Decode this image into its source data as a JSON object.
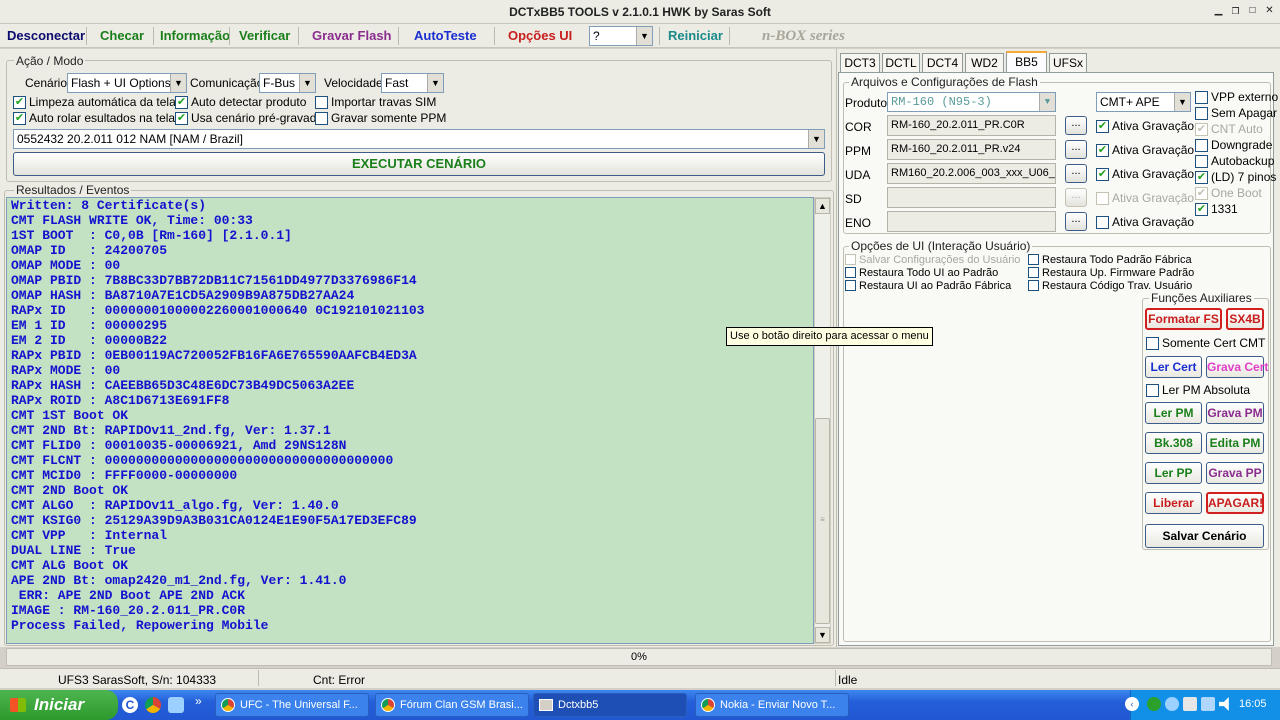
{
  "window": {
    "title": "DCTxBB5 TOOLS v 2.1.0.1 HWK by Saras Soft"
  },
  "menu": {
    "items": [
      "Desconectar",
      "Checar",
      "Informação",
      "Verificar",
      "Gravar Flash",
      "AutoTeste",
      "Opções UI",
      "Reiniciar"
    ],
    "help_value": "?",
    "brand": "n-BOX series"
  },
  "colors": {
    "disconnect": "#0b0b6e",
    "green": "#1a7f1a",
    "purple": "#8b2c8f",
    "blue": "#1a2fd0",
    "red": "#c81e1e",
    "teal": "#1a8a8a"
  },
  "acao": {
    "title": "Ação / Modo",
    "cenario_label": "Cenário",
    "cenario_value": "Flash + UI Options",
    "comunicacao_label": "Comunicação",
    "comunicacao_value": "F-Bus",
    "velocidade_label": "Velocidade",
    "velocidade_value": "Fast",
    "checks": [
      {
        "label": "Limpeza automática da tela",
        "checked": true
      },
      {
        "label": "Auto detectar produto",
        "checked": true
      },
      {
        "label": "Importar travas SIM",
        "checked": false
      },
      {
        "label": "Auto rolar esultados na tela",
        "checked": true
      },
      {
        "label": "Usa cenário pré-gravado",
        "checked": true
      },
      {
        "label": "Gravar somente PPM",
        "checked": false
      }
    ],
    "scenario_file": "0552432 20.2.011 012 NAM [NAM / Brazil]",
    "run_button": "EXECUTAR CENÁRIO"
  },
  "results": {
    "title": "Resultados / Eventos",
    "lines": [
      "Written: 8 Certificate(s)",
      "CMT FLASH WRITE OK, Time: 00:33",
      "1ST BOOT  : C0,0B [Rm-160] [2.1.0.1]",
      "OMAP ID   : 24200705",
      "OMAP MODE : 00",
      "OMAP PBID : 7B8BC33D7BB72DB11C71561DD4977D3376986F14",
      "OMAP HASH : BA8710A7E1CD5A2909B9A875DB27AA24",
      "RAPx ID   : 00000001000002260001000640 0C192101021103",
      "EM 1 ID   : 00000295",
      "EM 2 ID   : 00000B22",
      "RAPx PBID : 0EB00119AC720052FB16FA6E765590AAFCB4ED3A",
      "RAPx MODE : 00",
      "RAPx HASH : CAEEBB65D3C48E6DC73B49DC5063A2EE",
      "RAPx ROID : A8C1D6713E691FF8",
      "CMT 1ST Boot OK",
      "CMT 2ND Bt: RAPIDOv11_2nd.fg, Ver: 1.37.1",
      "CMT FLID0 : 00010035-00006921, Amd 29NS128N",
      "CMT FLCNT : 0000000000000000000000000000000000000",
      "CMT MCID0 : FFFF0000-00000000",
      "CMT 2ND Boot OK",
      "CMT ALGO  : RAPIDOv11_algo.fg, Ver: 1.40.0",
      "CMT KSIG0 : 25129A39D9A3B031CA0124E1E90F5A17ED3EFC89",
      "CMT VPP   : Internal",
      "DUAL LINE : True",
      "CMT ALG Boot OK",
      "APE 2ND Bt: omap2420_m1_2nd.fg, Ver: 1.41.0",
      " ERR: APE 2ND Boot APE 2ND ACK",
      "IMAGE : RM-160_20.2.011_PR.C0R",
      "Process Failed, Repowering Mobile"
    ]
  },
  "tooltip": "Use o botão direito para acessar o menu",
  "tabs": [
    "DCT3",
    "DCTL",
    "DCT4",
    "WD2",
    "BB5",
    "UFSx"
  ],
  "active_tab": "BB5",
  "arquivos": {
    "title": "Arquivos e Configurações de Flash",
    "produto_label": "Produto",
    "produto_value": "RM-160  (N95-3)",
    "mode_value": "CMT+ APE",
    "rows": [
      {
        "label": "COR",
        "file": "RM-160_20.2.011_PR.C0R",
        "ativa": "Ativa Gravação",
        "checked": true,
        "enabled": true
      },
      {
        "label": "PPM",
        "file": "RM-160_20.2.011_PR.v24",
        "ativa": "Ativa Gravação",
        "checked": true,
        "enabled": true
      },
      {
        "label": "UDA",
        "file": "RM160_20.2.006_003_xxx_U06_",
        "ativa": "Ativa Gravação",
        "checked": true,
        "enabled": true
      },
      {
        "label": "SD",
        "file": "",
        "ativa": "Ativa Gravação",
        "checked": false,
        "enabled": false
      },
      {
        "label": "ENO",
        "file": "",
        "ativa": "Ativa Gravação",
        "checked": false,
        "enabled": true
      }
    ],
    "dots": "...",
    "options": [
      {
        "label": "VPP externo",
        "checked": false,
        "enabled": true
      },
      {
        "label": "Sem Apagar",
        "checked": false,
        "enabled": true
      },
      {
        "label": "CNT Auto",
        "checked": true,
        "enabled": false
      },
      {
        "label": "Downgrade",
        "checked": false,
        "enabled": true
      },
      {
        "label": "Autobackup",
        "checked": false,
        "enabled": true
      },
      {
        "label": "(LD) 7 pinos",
        "checked": true,
        "enabled": true
      },
      {
        "label": "One Boot",
        "checked": true,
        "enabled": false
      },
      {
        "label": "1331",
        "checked": true,
        "enabled": true
      }
    ]
  },
  "opcoes_ui": {
    "title": "Opções de UI (Interação Usuário)",
    "items": [
      {
        "label": "Salvar Configurações do Usuário",
        "enabled": false
      },
      {
        "label": "Restaura Todo Padrão Fábrica",
        "enabled": true
      },
      {
        "label": "Restaura Todo UI ao Padrão",
        "enabled": true
      },
      {
        "label": "Restaura Up. Firmware Padrão",
        "enabled": true
      },
      {
        "label": "Restaura UI ao Padrão Fábrica",
        "enabled": true
      },
      {
        "label": "Restaura Código Trav. Usuário",
        "enabled": true
      }
    ]
  },
  "funcoes": {
    "title": "Funções Auxiliares",
    "formatar_fs": "Formatar FS",
    "sx4b": "SX4B",
    "somente_cert": "Somente Cert CMT",
    "ler_cert": "Ler Cert",
    "grava_cert": "Grava Cert",
    "ler_pm_absoluta": "Ler PM Absoluta",
    "ler_pm": "Ler PM",
    "grava_pm": "Grava PM",
    "bk308": "Bk.308",
    "edita_pm": "Edita PM",
    "ler_pp": "Ler PP",
    "grava_pp": "Grava PP",
    "liberar": "Liberar",
    "apagar": "APAGAR!",
    "salvar_cenario": "Salvar Cenário"
  },
  "progress": "0%",
  "status": {
    "left": "UFS3 SarasSoft, S/n: 104333",
    "mid": "Cnt: Error",
    "right": "Idle"
  },
  "taskbar": {
    "start": "Iniciar",
    "buttons": [
      {
        "label": "UFC - The Universal F...",
        "active": false
      },
      {
        "label": "Fórum Clan GSM Brasi...",
        "active": false
      },
      {
        "label": "Dctxbb5",
        "active": true
      },
      {
        "label": "Nokia - Enviar Novo T...",
        "active": false
      }
    ],
    "clock": "16:05"
  }
}
